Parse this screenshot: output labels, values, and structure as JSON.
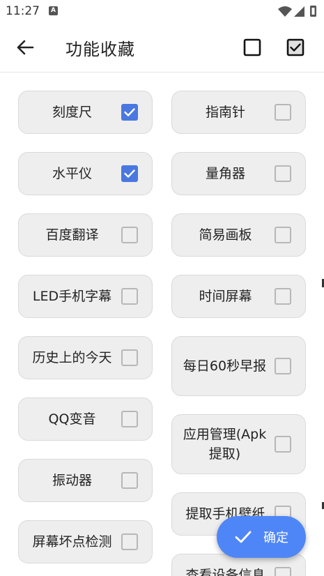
{
  "status": {
    "time": "11:27",
    "notification_letter": "A"
  },
  "app_bar": {
    "title": "功能收藏"
  },
  "features": {
    "left": [
      {
        "label": "刻度尺",
        "checked": true
      },
      {
        "label": "水平仪",
        "checked": true
      },
      {
        "label": "百度翻译",
        "checked": false
      },
      {
        "label": "LED手机字幕",
        "checked": false
      },
      {
        "label": "历史上的今天",
        "checked": false
      },
      {
        "label": "QQ变音",
        "checked": false
      },
      {
        "label": "振动器",
        "checked": false
      },
      {
        "label": "屏幕坏点检测",
        "checked": false
      }
    ],
    "right": [
      {
        "label": "指南针",
        "checked": false
      },
      {
        "label": "量角器",
        "checked": false
      },
      {
        "label": "简易画板",
        "checked": false
      },
      {
        "label": "时间屏幕",
        "checked": false
      },
      {
        "label": "每日60秒早报",
        "checked": false
      },
      {
        "label": "应用管理(Apk提取)",
        "checked": false
      },
      {
        "label": "提取手机壁纸",
        "checked": false
      },
      {
        "label": "查看设备信息",
        "checked": false
      }
    ]
  },
  "fab": {
    "label": "确定"
  },
  "colors": {
    "accent": "#4f86f7",
    "checkbox_on": "#4a78e0",
    "card_bg": "#eeeeee"
  }
}
